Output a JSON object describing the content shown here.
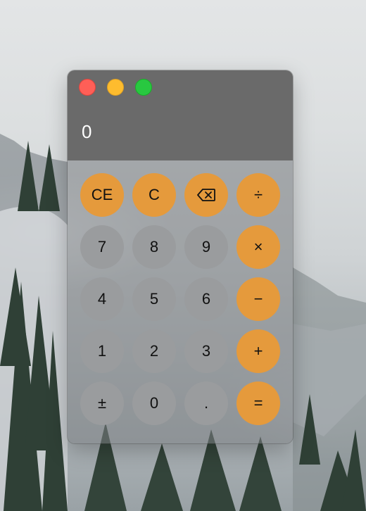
{
  "window": {
    "traffic_lights": {
      "close_color": "#fe5f57",
      "minimize_color": "#febc2e",
      "zoom_color": "#28c840"
    },
    "display": "0"
  },
  "keys": {
    "row1": [
      "CE",
      "C",
      "backspace-icon",
      "÷"
    ],
    "row2": [
      "7",
      "8",
      "9",
      "×"
    ],
    "row3": [
      "4",
      "5",
      "6",
      "−"
    ],
    "row4": [
      "1",
      "2",
      "3",
      "+"
    ],
    "row5": [
      "±",
      "0",
      ".",
      "="
    ]
  },
  "labels": {
    "ce": "CE",
    "c": "C",
    "divide": "÷",
    "seven": "7",
    "eight": "8",
    "nine": "9",
    "multiply": "×",
    "four": "4",
    "five": "5",
    "six": "6",
    "minus": "−",
    "one": "1",
    "two": "2",
    "three": "3",
    "plus": "+",
    "plus_minus": "±",
    "zero": "0",
    "decimal": ".",
    "equals": "="
  },
  "colors": {
    "operator_key": "#e59a3c",
    "number_key": "#9a9c9e",
    "display_bg": "#6a6a6a",
    "display_text": "#ffffff"
  }
}
